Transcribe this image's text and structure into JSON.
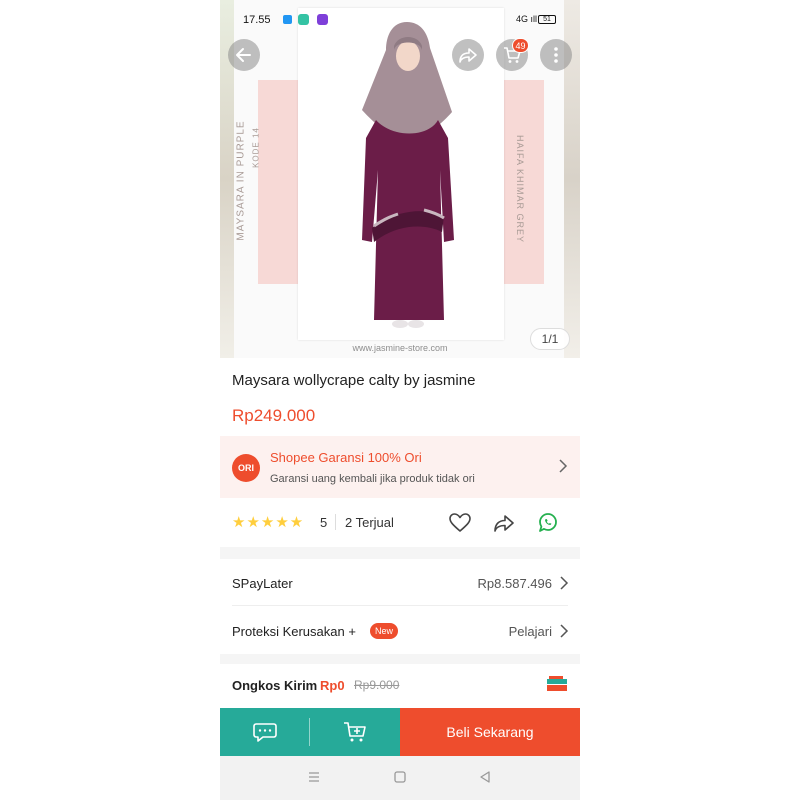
{
  "status_bar": {
    "time": "17.55",
    "signal": "4G ıll",
    "battery": "51"
  },
  "top_actions": {
    "cart_badge": "49"
  },
  "product_image": {
    "left_label": "MAYSARA IN PURPLE",
    "left_sublabel": "KODE 14",
    "right_label": "HAIFA KHIMAR GREY",
    "website": "www.jasmine-store.com",
    "counter": "1/1"
  },
  "product": {
    "title": "Maysara wollycrape calty by jasmine",
    "price": "Rp249.000"
  },
  "guarantee": {
    "badge": "ORI",
    "title": "Shopee Garansi 100% Ori",
    "subtitle": "Garansi uang kembali jika produk tidak ori"
  },
  "rating": {
    "stars": "★★★★★",
    "value": "5",
    "sold": "2 Terjual",
    "stars_value": 5
  },
  "paylater": {
    "label": "SPayLater",
    "value": "Rp8.587.496"
  },
  "protection": {
    "label": "Proteksi Kerusakan +",
    "badge": "New",
    "action": "Pelajari"
  },
  "shipping": {
    "label": "Ongkos Kirim",
    "free": "Rp0",
    "original": "Rp9.000"
  },
  "bottom_bar": {
    "buy_label": "Beli Sekarang"
  },
  "colors": {
    "accent": "#ee4d2d",
    "teal": "#26aa99",
    "star": "#ffce3d",
    "dress": "#6b1d48",
    "khimar": "#a58f97"
  },
  "icons": [
    "back-icon",
    "share-icon",
    "cart-icon",
    "more-icon",
    "chevron-right-icon",
    "heart-icon",
    "whatsapp-icon",
    "chat-icon",
    "add-to-cart-icon",
    "menu-icon",
    "home-icon",
    "nav-back-icon"
  ]
}
